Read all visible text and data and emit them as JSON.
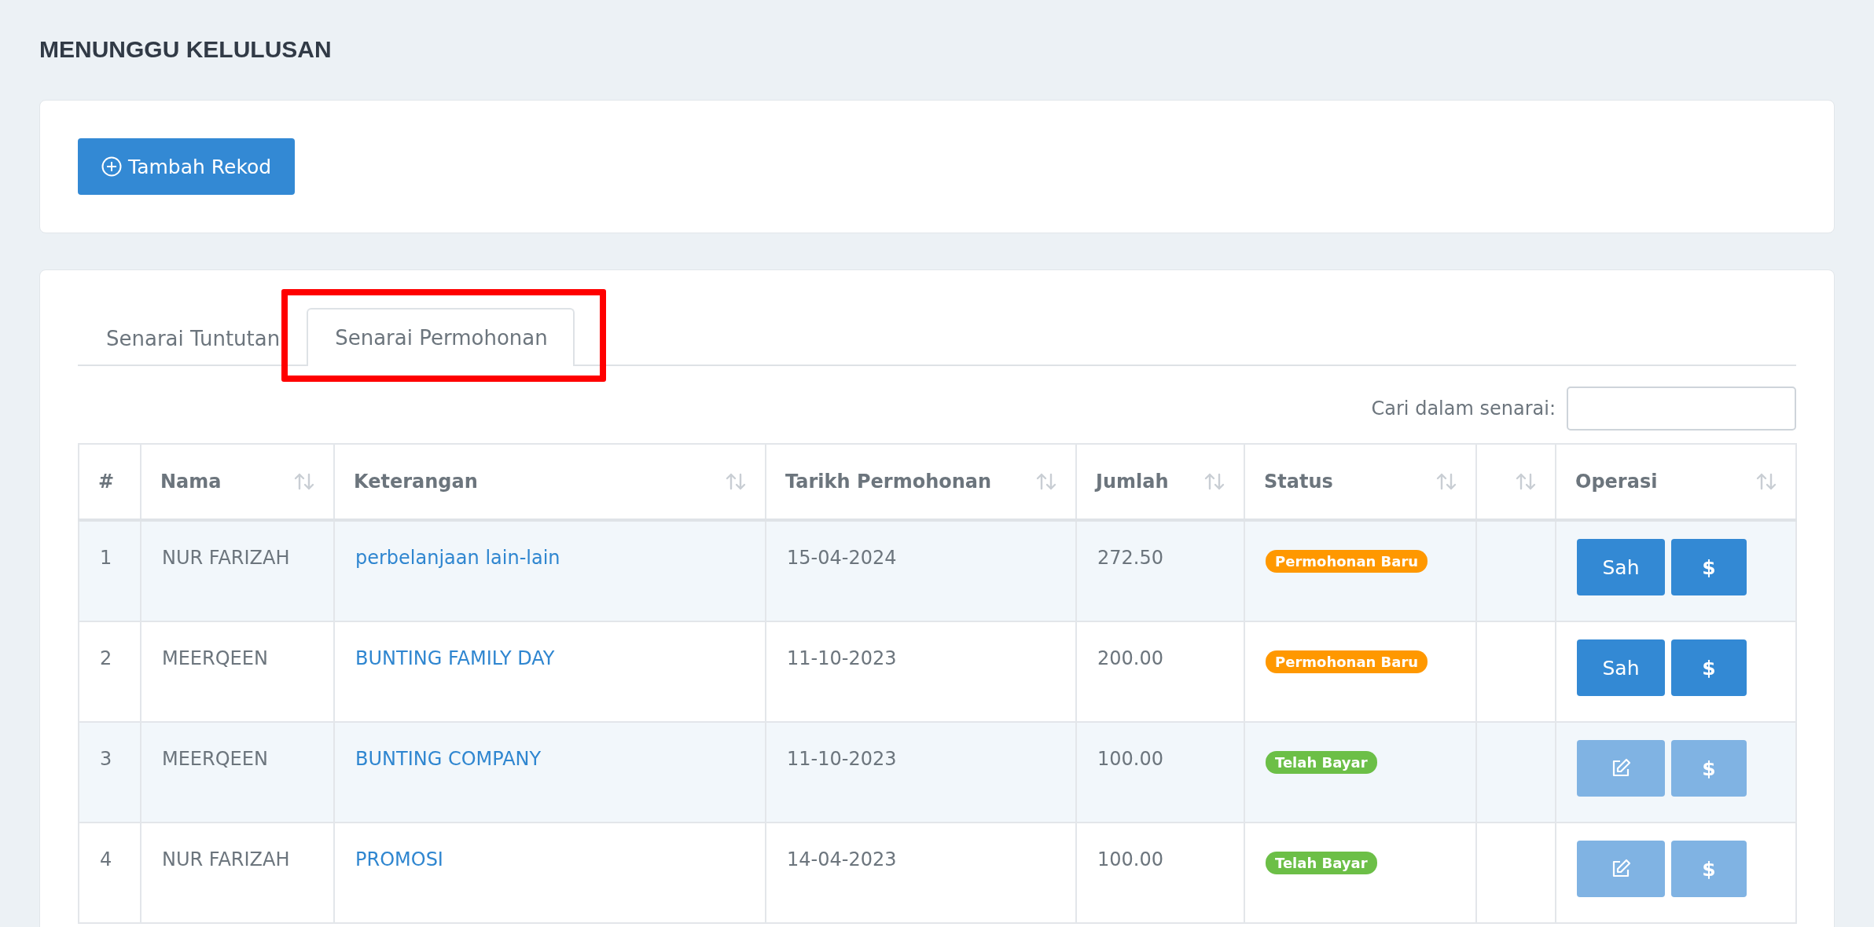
{
  "page_title": "MENUNGGU KELULUSAN",
  "add_button": {
    "label": "Tambah Rekod"
  },
  "tabs": [
    {
      "label": "Senarai Tuntutan",
      "selected": false,
      "highlighted": false
    },
    {
      "label": "Senarai Permohonan",
      "selected": true,
      "highlighted": true
    }
  ],
  "search": {
    "label": "Cari dalam senarai:"
  },
  "table": {
    "columns": [
      {
        "label": "#",
        "sortable": false
      },
      {
        "label": "Nama",
        "sortable": true
      },
      {
        "label": "Keterangan",
        "sortable": true
      },
      {
        "label": "Tarikh Permohonan",
        "sortable": true
      },
      {
        "label": "Jumlah",
        "sortable": true
      },
      {
        "label": "Status",
        "sortable": true
      },
      {
        "sortable": true
      },
      {
        "label": "Operasi",
        "sortable": true
      }
    ],
    "rows": [
      {
        "no": "1",
        "nama": "NUR FARIZAH",
        "keterangan": "perbelanjaan lain-lain",
        "tarikh": "15-04-2024",
        "jumlah": "272.50",
        "status": {
          "label": "Permohonan Baru",
          "color": "#ff9800"
        },
        "operations": [
          {
            "kind": "text",
            "label": "Sah",
            "disabled": false
          },
          {
            "kind": "text",
            "label": "$",
            "disabled": false
          }
        ]
      },
      {
        "no": "2",
        "nama": "MEERQEEN",
        "keterangan": "BUNTING FAMILY DAY",
        "tarikh": "11-10-2023",
        "jumlah": "200.00",
        "status": {
          "label": "Permohonan Baru",
          "color": "#ff9800"
        },
        "operations": [
          {
            "kind": "text",
            "label": "Sah",
            "disabled": false
          },
          {
            "kind": "text",
            "label": "$",
            "disabled": false
          }
        ]
      },
      {
        "no": "3",
        "nama": "MEERQEEN",
        "keterangan": "BUNTING COMPANY",
        "tarikh": "11-10-2023",
        "jumlah": "100.00",
        "status": {
          "label": "Telah Bayar",
          "color": "#6cbf47"
        },
        "operations": [
          {
            "kind": "edit",
            "disabled": true
          },
          {
            "kind": "text",
            "label": "$",
            "disabled": true
          }
        ]
      },
      {
        "no": "4",
        "nama": "NUR FARIZAH",
        "keterangan": "PROMOSI",
        "tarikh": "14-04-2023",
        "jumlah": "100.00",
        "status": {
          "label": "Telah Bayar",
          "color": "#6cbf47"
        },
        "operations": [
          {
            "kind": "edit",
            "disabled": true
          },
          {
            "kind": "text",
            "label": "$",
            "disabled": true
          }
        ]
      }
    ]
  }
}
